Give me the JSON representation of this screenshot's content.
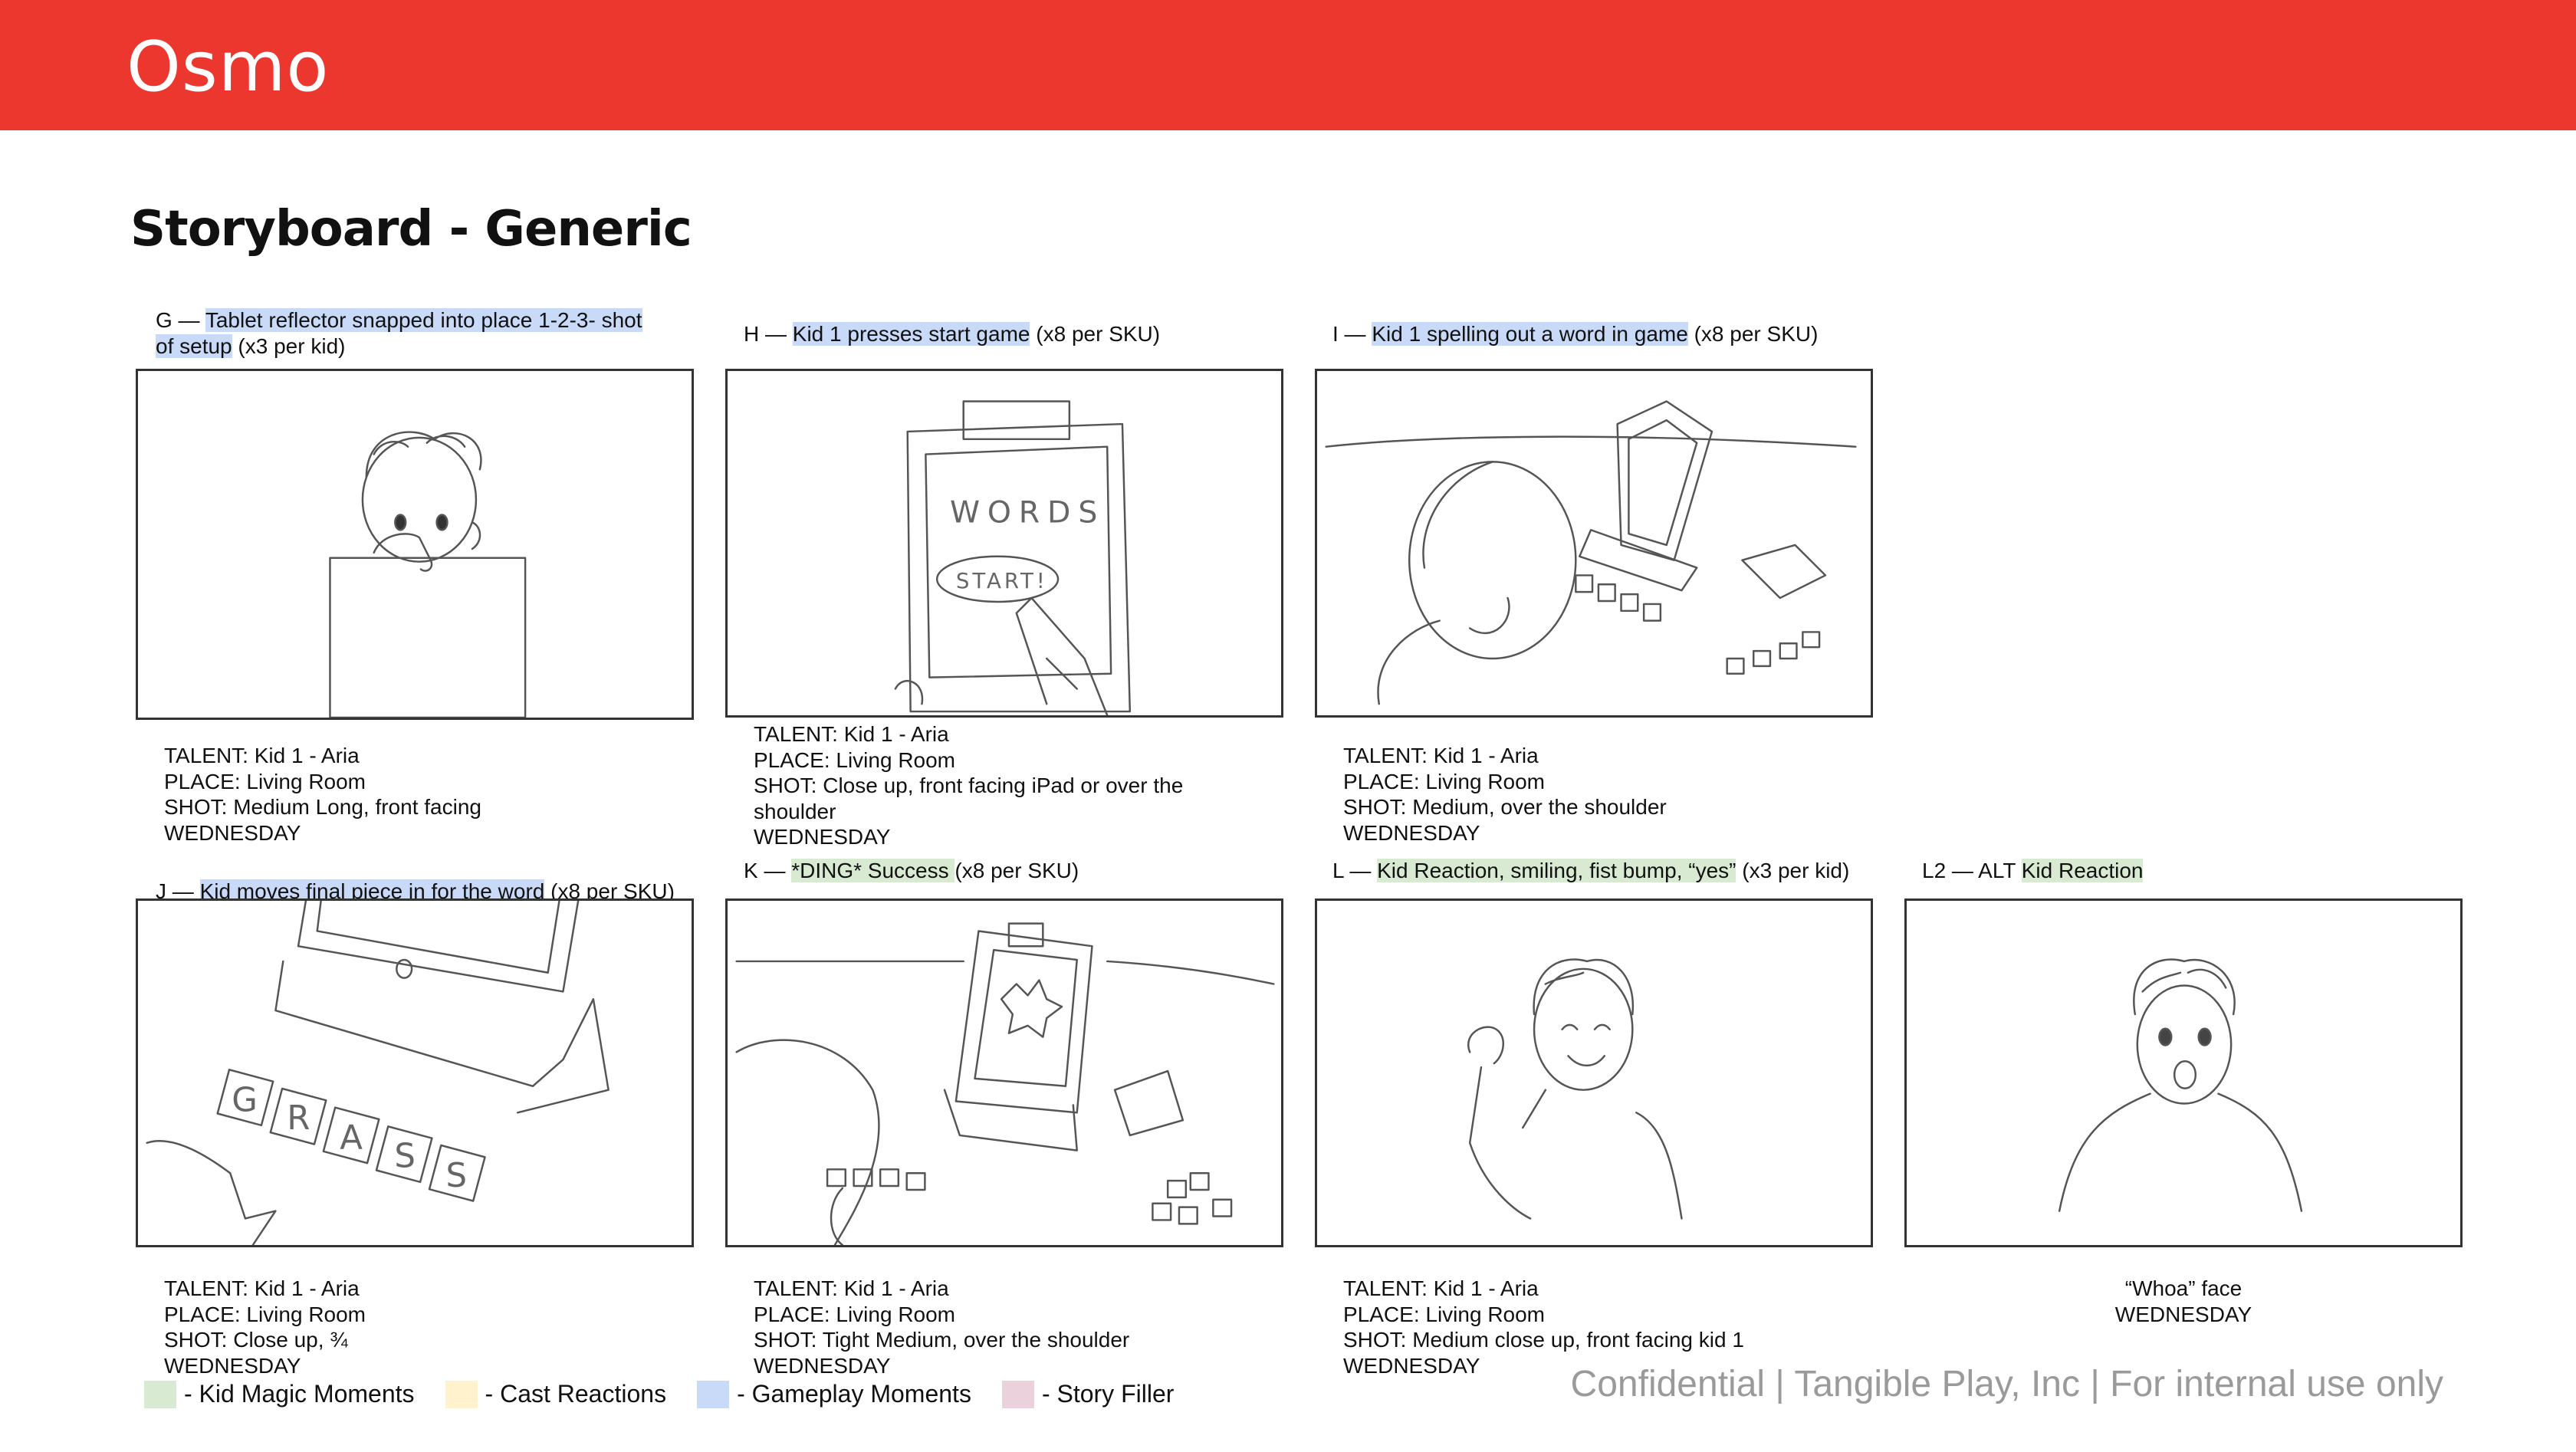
{
  "brand": {
    "logo_text": "Osmo",
    "header_color": "#ec372e"
  },
  "page_title": "Storyboard - Generic",
  "panels": {
    "G": {
      "caption_prefix": "G — ",
      "caption_highlight": "Tablet reflector snapped into place 1-2-3- shot of setup",
      "caption_suffix": " (x3 per kid)",
      "talent": "TALENT: Kid 1 - Aria",
      "place": "PLACE: Living Room",
      "shot": "SHOT: Medium Long, front facing",
      "day": "WEDNESDAY"
    },
    "H": {
      "caption_prefix": "H — ",
      "caption_highlight": "Kid 1 presses start  game",
      "caption_suffix": " (x8 per SKU)",
      "screen_word": "WORDS",
      "screen_button": "START!",
      "talent": "TALENT: Kid 1 - Aria",
      "place": "PLACE: Living Room",
      "shot": "SHOT: Close up, front facing iPad or over the shoulder",
      "day": "WEDNESDAY"
    },
    "I": {
      "caption_prefix": "I — ",
      "caption_highlight": "Kid 1 spelling out a word in game",
      "caption_suffix": "  (x8 per SKU)",
      "talent": "TALENT: Kid 1 - Aria",
      "place": "PLACE: Living Room",
      "shot": "SHOT: Medium, over the shoulder",
      "day": "WEDNESDAY"
    },
    "J": {
      "caption_prefix": "J — ",
      "caption_highlight": "Kid moves final piece in for the word",
      "caption_suffix": " (x8 per SKU)",
      "tile_letters": [
        "G",
        "R",
        "A",
        "S",
        "S"
      ],
      "talent": "TALENT: Kid 1 - Aria",
      "place": "PLACE: Living Room",
      "shot": "SHOT: Close up, ¾",
      "day": "WEDNESDAY"
    },
    "K": {
      "caption_prefix": "K — ",
      "caption_highlight": "*DING* Success ",
      "caption_suffix": " (x8 per SKU)",
      "talent": "TALENT: Kid 1 - Aria",
      "place": "PLACE: Living Room",
      "shot": "SHOT: Tight Medium, over the shoulder",
      "day": "WEDNESDAY"
    },
    "L": {
      "caption_prefix": "L — ",
      "caption_highlight": "Kid Reaction, smiling, fist bump, “yes”",
      "caption_suffix": " (x3 per kid)",
      "talent": "TALENT: Kid 1 - Aria",
      "place": "PLACE: Living Room",
      "shot": "SHOT: Medium close up, front facing kid 1",
      "day": "WEDNESDAY"
    },
    "L2": {
      "caption_prefix": "L2 — ALT  ",
      "caption_highlight": "Kid Reaction",
      "caption_suffix": "",
      "note": "“Whoa” face",
      "day": "WEDNESDAY"
    }
  },
  "legend": [
    {
      "label": "- Kid Magic Moments",
      "color": "#d9ead3"
    },
    {
      "label": "- Cast Reactions",
      "color": "#fff2cc"
    },
    {
      "label": "- Gameplay Moments",
      "color": "#c9daf8"
    },
    {
      "label": "- Story Filler",
      "color": "#ead1dc"
    }
  ],
  "footer": "Confidential | Tangible Play, Inc | For internal use only"
}
